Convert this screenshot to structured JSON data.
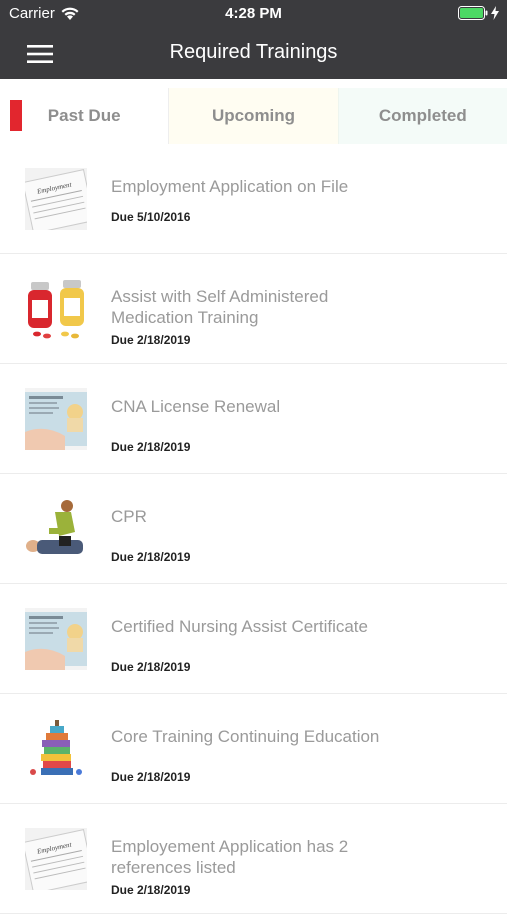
{
  "status_bar": {
    "carrier": "Carrier",
    "time": "4:28 PM"
  },
  "nav": {
    "title": "Required Trainings"
  },
  "tabs": [
    {
      "label": "Past Due",
      "active": true
    },
    {
      "label": "Upcoming",
      "active": false
    },
    {
      "label": "Completed",
      "active": false
    }
  ],
  "colors": {
    "header_bg": "#3b3b3e",
    "active_indicator": "#e2262e",
    "title_text": "#9a9a9a"
  },
  "items": [
    {
      "title": "Employment Application on File",
      "due": "Due 5/10/2016",
      "icon": "application-form-icon"
    },
    {
      "title": "Assist with Self Administered Medication Training",
      "due": "Due 2/18/2019",
      "icon": "medication-bottles-icon"
    },
    {
      "title": "CNA License Renewal",
      "due": "Due 2/18/2019",
      "icon": "license-card-icon"
    },
    {
      "title": "CPR",
      "due": "Due 2/18/2019",
      "icon": "cpr-icon"
    },
    {
      "title": "Certified Nursing Assist Certificate",
      "due": "Due 2/18/2019",
      "icon": "license-card-icon"
    },
    {
      "title": "Core Training Continuing Education",
      "due": "Due 2/18/2019",
      "icon": "books-icon"
    },
    {
      "title": "Employement Application has 2 references listed",
      "due": "Due 2/18/2019",
      "icon": "application-form-icon"
    }
  ]
}
